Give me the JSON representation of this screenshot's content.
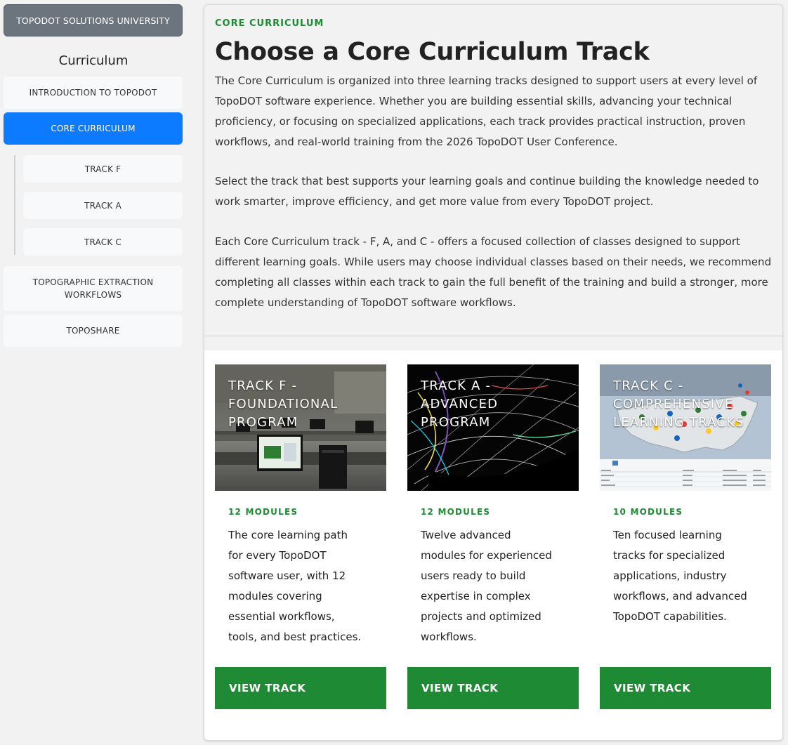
{
  "sidebar": {
    "brand": "TOPODOT SOLUTIONS UNIVERSITY",
    "heading": "Curriculum",
    "items": [
      {
        "label": "INTRODUCTION TO TOPODOT"
      },
      {
        "label": "CORE CURRICULUM"
      },
      {
        "label": "TRACK F"
      },
      {
        "label": "TRACK A"
      },
      {
        "label": "TRACK C"
      },
      {
        "label": "TOPOGRAPHIC EXTRACTION WORKFLOWS"
      },
      {
        "label": "TOPOSHARE"
      }
    ],
    "active_item": "CORE CURRICULUM"
  },
  "main": {
    "eyebrow": "CORE CURRICULUM",
    "title": "Choose a Core Curriculum Track",
    "paragraphs": [
      "The Core Curriculum is organized into three learning tracks designed to support users at every level of TopoDOT software experience. Whether you are building essential skills, advancing your technical proficiency, or focusing on specialized applications, each track provides practical instruction, proven workflows, and real-world training from the 2026 TopoDOT User Conference.",
      "Select the track that best supports your learning goals and continue building the knowledge needed to work smarter, improve efficiency, and get more value from every TopoDOT project.",
      "Each Core Curriculum track - F, A, and C - offers a focused collection of classes designed to support different learning goals. While users may choose individual classes based on their needs, we recommend completing all classes within each track to gain the full benefit of the training and build a stronger, more complete understanding of TopoDOT software workflows."
    ],
    "cards": [
      {
        "image_title": "TRACK F - FOUNDATIONAL PROGRAM",
        "modules": "12 MODULES",
        "description": "The core learning path for every TopoDOT software user, with 12 modules covering essential workflows, tools, and best practices.",
        "button": "VIEW TRACK"
      },
      {
        "image_title": "TRACK A - ADVANCED PROGRAM",
        "modules": "12 MODULES",
        "description": "Twelve advanced modules for experienced users ready to build expertise in complex projects and optimized workflows.",
        "button": "VIEW TRACK"
      },
      {
        "image_title": "TRACK C - COMPREHENSIVE LEARNING TRACKS",
        "modules": "10 MODULES",
        "description": "Ten focused learning tracks for specialized applications, industry workflows, and advanced TopoDOT capabilities.",
        "button": "VIEW TRACK"
      }
    ]
  },
  "colors": {
    "accent_green": "#1f8a34",
    "active_blue": "#0d7bff",
    "brand_gray": "#6c757d"
  }
}
